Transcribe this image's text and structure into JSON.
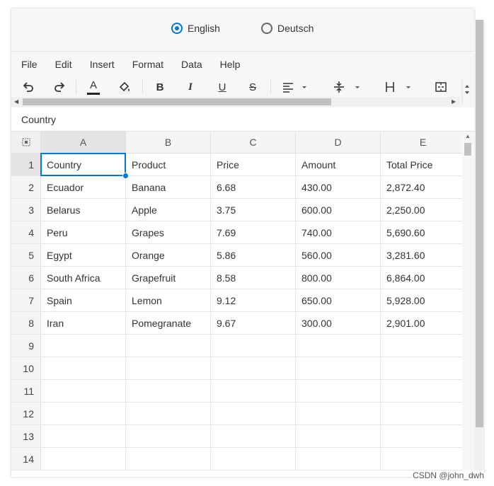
{
  "language": {
    "options": [
      {
        "label": "English",
        "checked": true
      },
      {
        "label": "Deutsch",
        "checked": false
      }
    ]
  },
  "menu": [
    "File",
    "Edit",
    "Insert",
    "Format",
    "Data",
    "Help"
  ],
  "toolbar": {
    "icons": [
      "undo-icon",
      "redo-icon",
      "font-color-icon",
      "fill-color-icon",
      "bold-icon",
      "italic-icon",
      "underline-icon",
      "strikethrough-icon",
      "align-left-icon",
      "align-vertical-icon",
      "horizontal-borders-icon",
      "merge-cells-icon"
    ],
    "font_color_letter": "A",
    "bold_letter": "B",
    "italic_letter": "I",
    "underline_letter": "U",
    "strike_letter": "S"
  },
  "formula_bar": {
    "value": "Country"
  },
  "sheet": {
    "columns": [
      "A",
      "B",
      "C",
      "D",
      "E"
    ],
    "row_numbers": [
      "1",
      "2",
      "3",
      "4",
      "5",
      "6",
      "7",
      "8",
      "9",
      "10",
      "11",
      "12",
      "13",
      "14"
    ],
    "rows": [
      [
        "Country",
        "Product",
        "Price",
        "Amount",
        "Total Price"
      ],
      [
        "Ecuador",
        "Banana",
        "6.68",
        "430.00",
        "2,872.40"
      ],
      [
        "Belarus",
        "Apple",
        "3.75",
        "600.00",
        "2,250.00"
      ],
      [
        "Peru",
        "Grapes",
        "7.69",
        "740.00",
        "5,690.60"
      ],
      [
        "Egypt",
        "Orange",
        "5.86",
        "560.00",
        "3,281.60"
      ],
      [
        "South Africa",
        "Grapefruit",
        "8.58",
        "800.00",
        "6,864.00"
      ],
      [
        "Spain",
        "Lemon",
        "9.12",
        "650.00",
        "5,928.00"
      ],
      [
        "Iran",
        "Pomegranate",
        "9.67",
        "300.00",
        "2,901.00"
      ],
      [
        "",
        "",
        "",
        "",
        ""
      ],
      [
        "",
        "",
        "",
        "",
        ""
      ],
      [
        "",
        "",
        "",
        "",
        ""
      ],
      [
        "",
        "",
        "",
        "",
        ""
      ],
      [
        "",
        "",
        "",
        "",
        ""
      ],
      [
        "",
        "",
        "",
        "",
        ""
      ]
    ],
    "active_cell": "A1"
  },
  "colors": {
    "accent": "#0078d4"
  },
  "watermark": "CSDN @john_dwh"
}
